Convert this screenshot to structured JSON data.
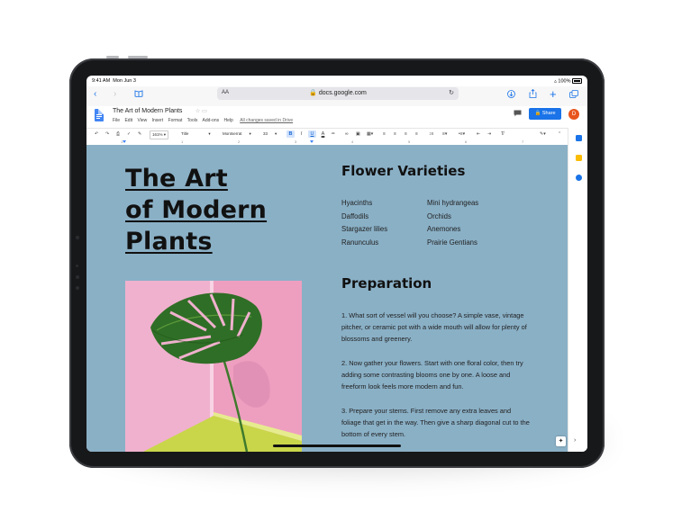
{
  "status_bar": {
    "time": "9:41 AM",
    "date": "Mon Jun 3",
    "battery": "100%"
  },
  "browser": {
    "text_size_label": "AA",
    "url": "docs.google.com"
  },
  "doc": {
    "title": "The Art of Modern Plants",
    "menu": [
      "File",
      "Edit",
      "View",
      "Insert",
      "Format",
      "Tools",
      "Add-ons",
      "Help"
    ],
    "save_status": "All changes saved in Drive",
    "share_label": "Share",
    "avatar_initial": "D"
  },
  "toolbar": {
    "zoom": "161%",
    "style": "Title",
    "font": "Montserrat",
    "font_size": "33",
    "bold": "B",
    "italic": "I",
    "underline": "U",
    "text_color": "A"
  },
  "ruler": {
    "numbers": [
      "1",
      "1",
      "2",
      "3",
      "4",
      "5",
      "6",
      "7"
    ]
  },
  "content": {
    "main_title": [
      "The Art",
      "of Modern",
      "Plants"
    ],
    "varieties_heading": "Flower Varieties",
    "varieties_col1": [
      "Hyacinths",
      "Daffodils",
      "Stargazer lilies",
      "Ranunculus"
    ],
    "varieties_col2": [
      "Mini hydrangeas",
      "Orchids",
      "Anemones",
      "Prairie Gentians"
    ],
    "preparation_heading": "Preparation",
    "steps": [
      "1. What sort of vessel will you choose? A simple vase, vintage pitcher, or ceramic pot with a wide mouth will allow for plenty of blossoms and greenery.",
      "2. Now gather your flowers. Start with one floral color, then try adding some contrasting blooms one by one. A loose and freeform look feels more modern and fun.",
      "3. Prepare your stems. First remove any extra leaves and foliage that get in the way. Then give a sharp diagonal cut to the bottom of every stem."
    ]
  },
  "colors": {
    "accent": "#1a73e8",
    "page_background": "#8ab0c6",
    "photo_background": "#f0b1ce",
    "avatar": "#e8541d"
  }
}
